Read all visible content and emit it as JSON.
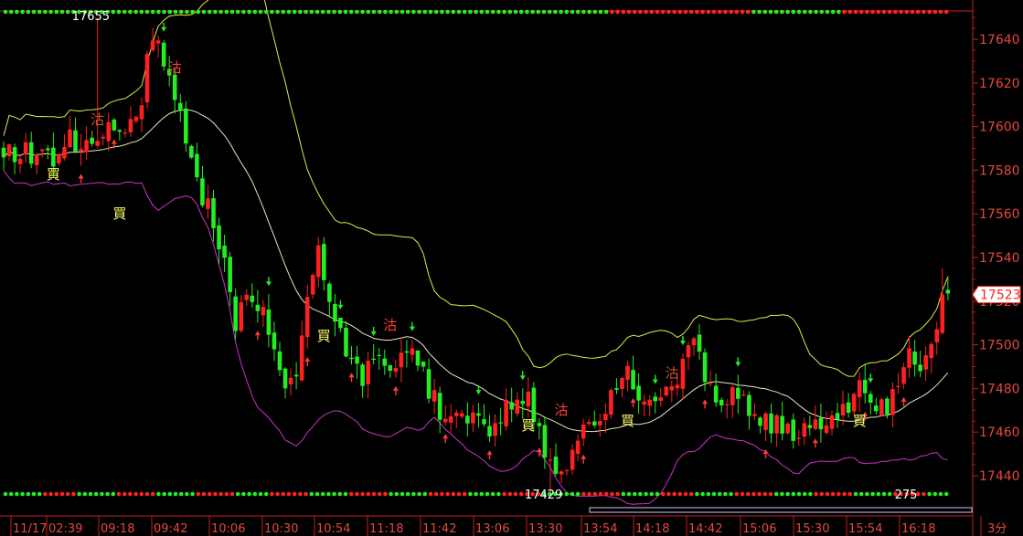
{
  "chart_data": {
    "type": "candlestick",
    "y_axis": {
      "range": [
        17428,
        17652
      ],
      "ticks": [
        17440,
        17460,
        17480,
        17500,
        17520,
        17540,
        17560,
        17580,
        17600,
        17620,
        17640
      ],
      "current_price": "17523"
    },
    "x_axis": {
      "labels": [
        "11/17",
        "02:39",
        "09:18",
        "09:42",
        "10:06",
        "10:30",
        "10:54",
        "11:18",
        "11:42",
        "13:06",
        "13:30",
        "13:54",
        "14:18",
        "14:42",
        "15:06",
        "15:30",
        "15:54",
        "16:18"
      ],
      "interval": "3分"
    },
    "annotations": [
      {
        "text": "17655",
        "bar": 17
      },
      {
        "text": "17429",
        "bar": 99
      },
      {
        "text": "275",
        "bar": 166
      }
    ],
    "signals": [
      {
        "text": "買",
        "bar": 9,
        "price": 17576,
        "color": "#ffff66"
      },
      {
        "text": "沽",
        "bar": 17,
        "price": 17601,
        "color": "#c8502a"
      },
      {
        "text": "買",
        "bar": 21,
        "price": 17558,
        "color": "#ffff66"
      },
      {
        "text": "沽",
        "bar": 31,
        "price": 17625,
        "color": "#ff3b3b"
      },
      {
        "text": "買",
        "bar": 58,
        "price": 17502,
        "color": "#ffff66"
      },
      {
        "text": "沽",
        "bar": 70,
        "price": 17507,
        "color": "#ff3b3b"
      },
      {
        "text": "買",
        "bar": 95,
        "price": 17461,
        "color": "#ffff66"
      },
      {
        "text": "沽",
        "bar": 101,
        "price": 17468,
        "color": "#ff3b3b"
      },
      {
        "text": "買",
        "bar": 113,
        "price": 17463,
        "color": "#ffff66"
      },
      {
        "text": "沽",
        "bar": 121,
        "price": 17485,
        "color": "#c8502a"
      },
      {
        "text": "買",
        "bar": 155,
        "price": 17463,
        "color": "#ffff66"
      }
    ],
    "colors": {
      "up": "#ff2020",
      "down": "#22ee22",
      "upper_band": "#e8e84a",
      "middle_band": "#e8e8c0",
      "lower_band": "#cc33cc",
      "axis_text": "#e6473e",
      "grid": "#c82020"
    }
  }
}
